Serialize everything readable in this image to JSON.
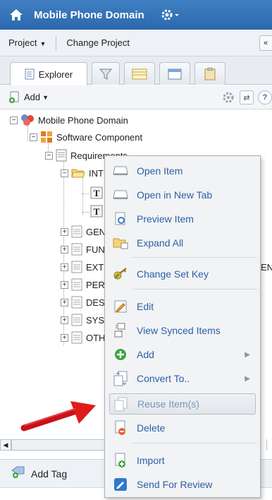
{
  "titlebar": {
    "title": "Mobile Phone Domain"
  },
  "projectbar": {
    "project": "Project",
    "change": "Change Project",
    "collapse": "«"
  },
  "tabs": [
    {
      "label": "Explorer"
    }
  ],
  "toolbar": {
    "add": "Add"
  },
  "tree": {
    "root": "Mobile Phone Domain",
    "component": "Software Component",
    "requirements": "Requirements",
    "children": [
      "INTI",
      "GEN",
      "FUN",
      "EXT",
      "PER",
      "DES",
      "SYS",
      "OTH"
    ],
    "ext_suffix": "ENT"
  },
  "menu": {
    "items": [
      {
        "label": "Open Item"
      },
      {
        "label": "Open in New Tab"
      },
      {
        "label": "Preview Item"
      },
      {
        "label": "Expand All"
      },
      {
        "label": "Change Set Key"
      },
      {
        "label": "Edit"
      },
      {
        "label": "View Synced Items"
      },
      {
        "label": "Add"
      },
      {
        "label": "Convert To.."
      },
      {
        "label": "Reuse Item(s)"
      },
      {
        "label": "Delete"
      },
      {
        "label": "Import"
      },
      {
        "label": "Send For Review"
      }
    ]
  },
  "tagbar": {
    "label": "Add Tag"
  },
  "colors": {
    "titlebar": "#2d68ad",
    "menu_text": "#2d5fa5",
    "arrow": "#e01b1b"
  }
}
